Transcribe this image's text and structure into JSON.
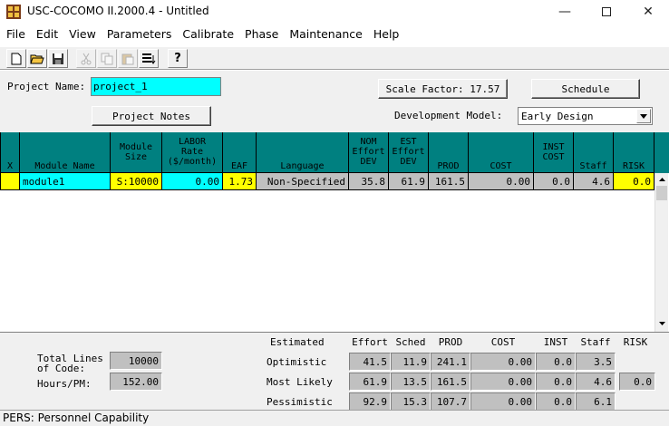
{
  "window": {
    "title": "USC-COCOMO II.2000.4 - Untitled"
  },
  "menu": [
    "File",
    "Edit",
    "View",
    "Parameters",
    "Calibrate",
    "Phase",
    "Maintenance",
    "Help"
  ],
  "toolbar": {
    "icons": [
      "new-document-icon",
      "open-folder-icon",
      "save-disk-icon",
      "cut-icon",
      "copy-icon",
      "paste-icon",
      "insert-module-icon",
      "help-icon"
    ]
  },
  "form": {
    "project_name_label": "Project Name:",
    "project_name_value": "project_1",
    "scale_factor_label": "Scale Factor: 17.57",
    "schedule_label": "Schedule",
    "project_notes_label": "Project Notes",
    "development_model_label": "Development Model:",
    "development_model_value": "Early Design"
  },
  "grid": {
    "headers": {
      "x": "X",
      "module_name": "Module Name",
      "module_size": [
        "Module",
        "Size"
      ],
      "labor_rate": [
        "LABOR",
        "Rate",
        "($/month)"
      ],
      "eaf": "EAF",
      "language": "Language",
      "nom_effort": [
        "NOM",
        "Effort",
        "DEV"
      ],
      "est_effort": [
        "EST",
        "Effort",
        "DEV"
      ],
      "prod": "PROD",
      "cost": "COST",
      "inst_cost": [
        "INST",
        "COST"
      ],
      "staff": "Staff",
      "risk": "RISK"
    },
    "row": {
      "x": "",
      "module_name": "module1",
      "module_size": "S:10000",
      "labor_rate": "0.00",
      "eaf": "1.73",
      "language": "Non-Specified",
      "nom_effort": "35.8",
      "est_effort": "61.9",
      "prod": "161.5",
      "cost": "0.00",
      "inst_cost": "0.0",
      "staff": "4.6",
      "risk": "0.0"
    },
    "colors": {
      "header_bg": "#008080",
      "editable_yellow": "#ffff00",
      "name_cyan": "#00ffff",
      "readonly_gray": "#c0c0c0"
    }
  },
  "summary": {
    "total_lines_label": "Total Lines\nof Code:",
    "total_lines_value": "10000",
    "hours_pm_label": "Hours/PM:",
    "hours_pm_value": "152.00",
    "headers": {
      "estimated": "Estimated",
      "effort": "Effort",
      "sched": "Sched",
      "prod": "PROD",
      "cost": "COST",
      "inst": "INST",
      "staff": "Staff",
      "risk": "RISK"
    },
    "rows": [
      {
        "label": "Optimistic",
        "effort": "41.5",
        "sched": "11.9",
        "prod": "241.1",
        "cost": "0.00",
        "inst": "0.0",
        "staff": "3.5",
        "risk": ""
      },
      {
        "label": "Most Likely",
        "effort": "61.9",
        "sched": "13.5",
        "prod": "161.5",
        "cost": "0.00",
        "inst": "0.0",
        "staff": "4.6",
        "risk": "0.0"
      },
      {
        "label": "Pessimistic",
        "effort": "92.9",
        "sched": "15.3",
        "prod": "107.7",
        "cost": "0.00",
        "inst": "0.0",
        "staff": "6.1",
        "risk": ""
      }
    ]
  },
  "status": {
    "text": "PERS: Personnel Capability"
  }
}
